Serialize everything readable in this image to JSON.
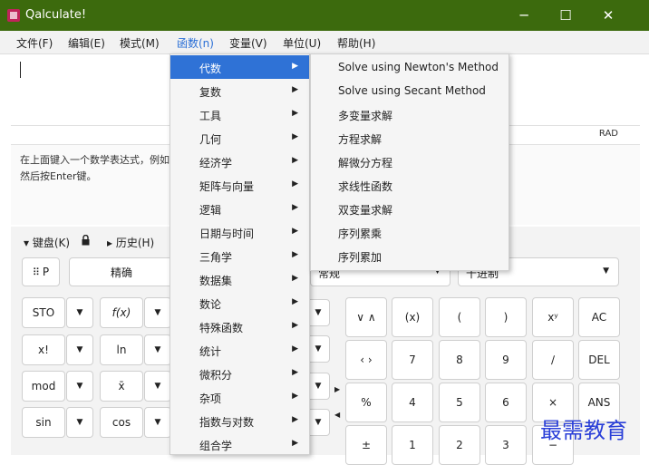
{
  "window": {
    "title": "Qalculate!",
    "minimize": "─",
    "maximize": "☐",
    "close": "✕"
  },
  "menubar": [
    "文件(F)",
    "编辑(E)",
    "模式(M)",
    "函数(n)",
    "变量(V)",
    "单位(U)",
    "帮助(H)"
  ],
  "status": {
    "angle_unit": "RAD"
  },
  "result_hint": "在上面键入一个数学表达式，例如\n然后按Enter键。",
  "keyboard": {
    "toggle_label": "▾ 键盘(K)",
    "lock_icon": "lock-icon",
    "history_label": "▸ 历史(H)",
    "mode_button": "P",
    "precision_label": "精确",
    "format_combo": "常规",
    "base_combo": "十进制",
    "left_buttons": [
      [
        "STO",
        "f(x)"
      ],
      [
        "x!",
        "ln"
      ],
      [
        "mod",
        "x̄"
      ],
      [
        "sin",
        "cos"
      ]
    ],
    "dd_arrow": "▼",
    "right_buttons": [
      [
        "∨ ∧",
        "(x)",
        "(",
        ")",
        "xʸ",
        "AC"
      ],
      [
        "‹ ›",
        "7",
        "8",
        "9",
        "∕",
        "DEL"
      ],
      [
        "%",
        "4",
        "5",
        "6",
        "×",
        "ANS"
      ],
      [
        "±",
        "1",
        "2",
        "3",
        "−",
        ""
      ]
    ]
  },
  "functions_menu": [
    "代数",
    "复数",
    "工具",
    "几何",
    "经济学",
    "矩阵与向量",
    "逻辑",
    "日期与时间",
    "三角学",
    "数据集",
    "数论",
    "特殊函数",
    "统计",
    "微积分",
    "杂项",
    "指数与对数",
    "组合学"
  ],
  "submenu_arrow": "▶",
  "algebra_submenu": [
    "Solve using Newton's Method",
    "Solve using Secant Method",
    "多变量求解",
    "方程求解",
    "解微分方程",
    "求线性函数",
    "双变量求解",
    "序列累乘",
    "序列累加"
  ],
  "watermark": "最需教育",
  "colors": {
    "titlebar": "#3c6a0d",
    "highlight": "#2f72d6",
    "watermark": "#2a3fd8"
  }
}
